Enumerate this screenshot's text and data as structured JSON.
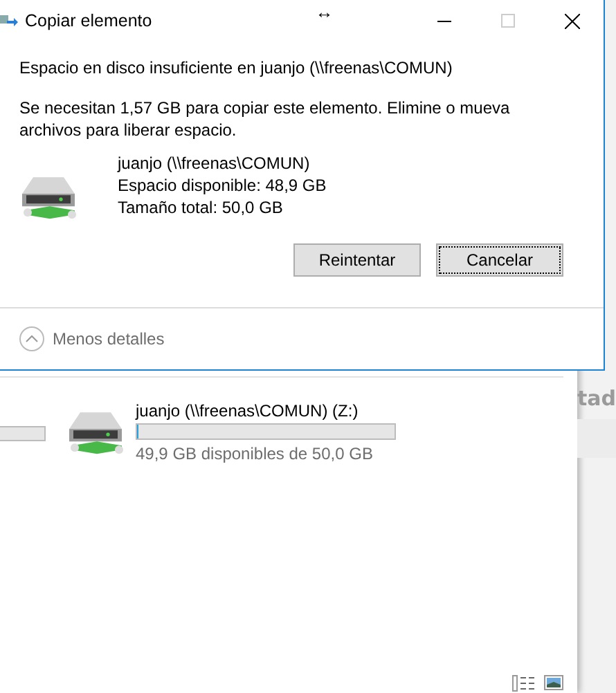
{
  "dialog": {
    "title": "Copiar elemento",
    "cursor_icon": "↔",
    "heading": "Espacio en disco insuficiente en juanjo (\\\\freenas\\COMUN)",
    "message": "Se necesitan 1,57 GB para copiar este elemento. Elimine o mueva archivos para liberar espacio.",
    "drive": {
      "name": "juanjo (\\\\freenas\\COMUN)",
      "free": "Espacio disponible: 48,9 GB",
      "total": "Tamaño total: 50,0 GB"
    },
    "buttons": [
      {
        "label": "Reintentar",
        "focused": false
      },
      {
        "label": "Cancelar",
        "focused": true
      }
    ],
    "details_toggle": {
      "label": "Menos detalles",
      "expanded": true
    }
  },
  "explorer": {
    "drive": {
      "name": "juanjo (\\\\freenas\\COMUN) (Z:)",
      "level": 0.002,
      "info": "49,9 GB disponibles de 50,0 GB"
    },
    "side_text": "tad"
  }
}
